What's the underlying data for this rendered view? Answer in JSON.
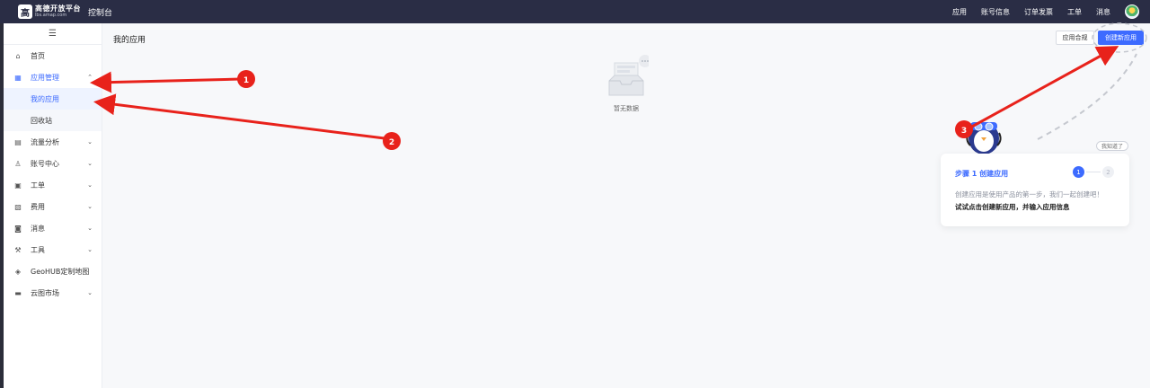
{
  "header": {
    "logo_mark": "高",
    "logo_title": "高德开放平台",
    "logo_sub": "lbs.amap.com",
    "console_label": "控制台",
    "nav": [
      "应用",
      "账号信息",
      "订单发票",
      "工单",
      "消息"
    ]
  },
  "sidebar": {
    "collapse_icon": "☰",
    "items": [
      {
        "label": "首页",
        "icon": "home-icon"
      },
      {
        "label": "应用管理",
        "icon": "grid-icon"
      },
      {
        "label": "我的应用"
      },
      {
        "label": "回收站"
      },
      {
        "label": "流量分析",
        "icon": "chart-icon"
      },
      {
        "label": "账号中心",
        "icon": "user-icon"
      },
      {
        "label": "工单",
        "icon": "ticket-icon"
      },
      {
        "label": "费用",
        "icon": "wallet-icon"
      },
      {
        "label": "消息",
        "icon": "message-icon"
      },
      {
        "label": "工具",
        "icon": "tool-icon"
      },
      {
        "label": "GeoHUB定制地图",
        "icon": "layers-icon"
      },
      {
        "label": "云图市场",
        "icon": "store-icon"
      }
    ]
  },
  "main": {
    "page_title": "我的应用",
    "compliance_button": "应用合规",
    "create_button": "创建新应用",
    "empty_text": "暂无数据"
  },
  "guide": {
    "step_title": "步骤 1 创建应用",
    "line1": "创建应用是使用产品的第一步，我们一起创建吧！",
    "line2": "试试点击创建新应用，并输入应用信息",
    "step1": "1",
    "step2": "2",
    "got_it": "我知道了"
  },
  "annotations": {
    "badge1": "1",
    "badge2": "2",
    "badge3": "3",
    "arrow_color": "#e8221b"
  },
  "colors": {
    "topbar": "#2a2d45",
    "accent": "#3d6bff"
  }
}
